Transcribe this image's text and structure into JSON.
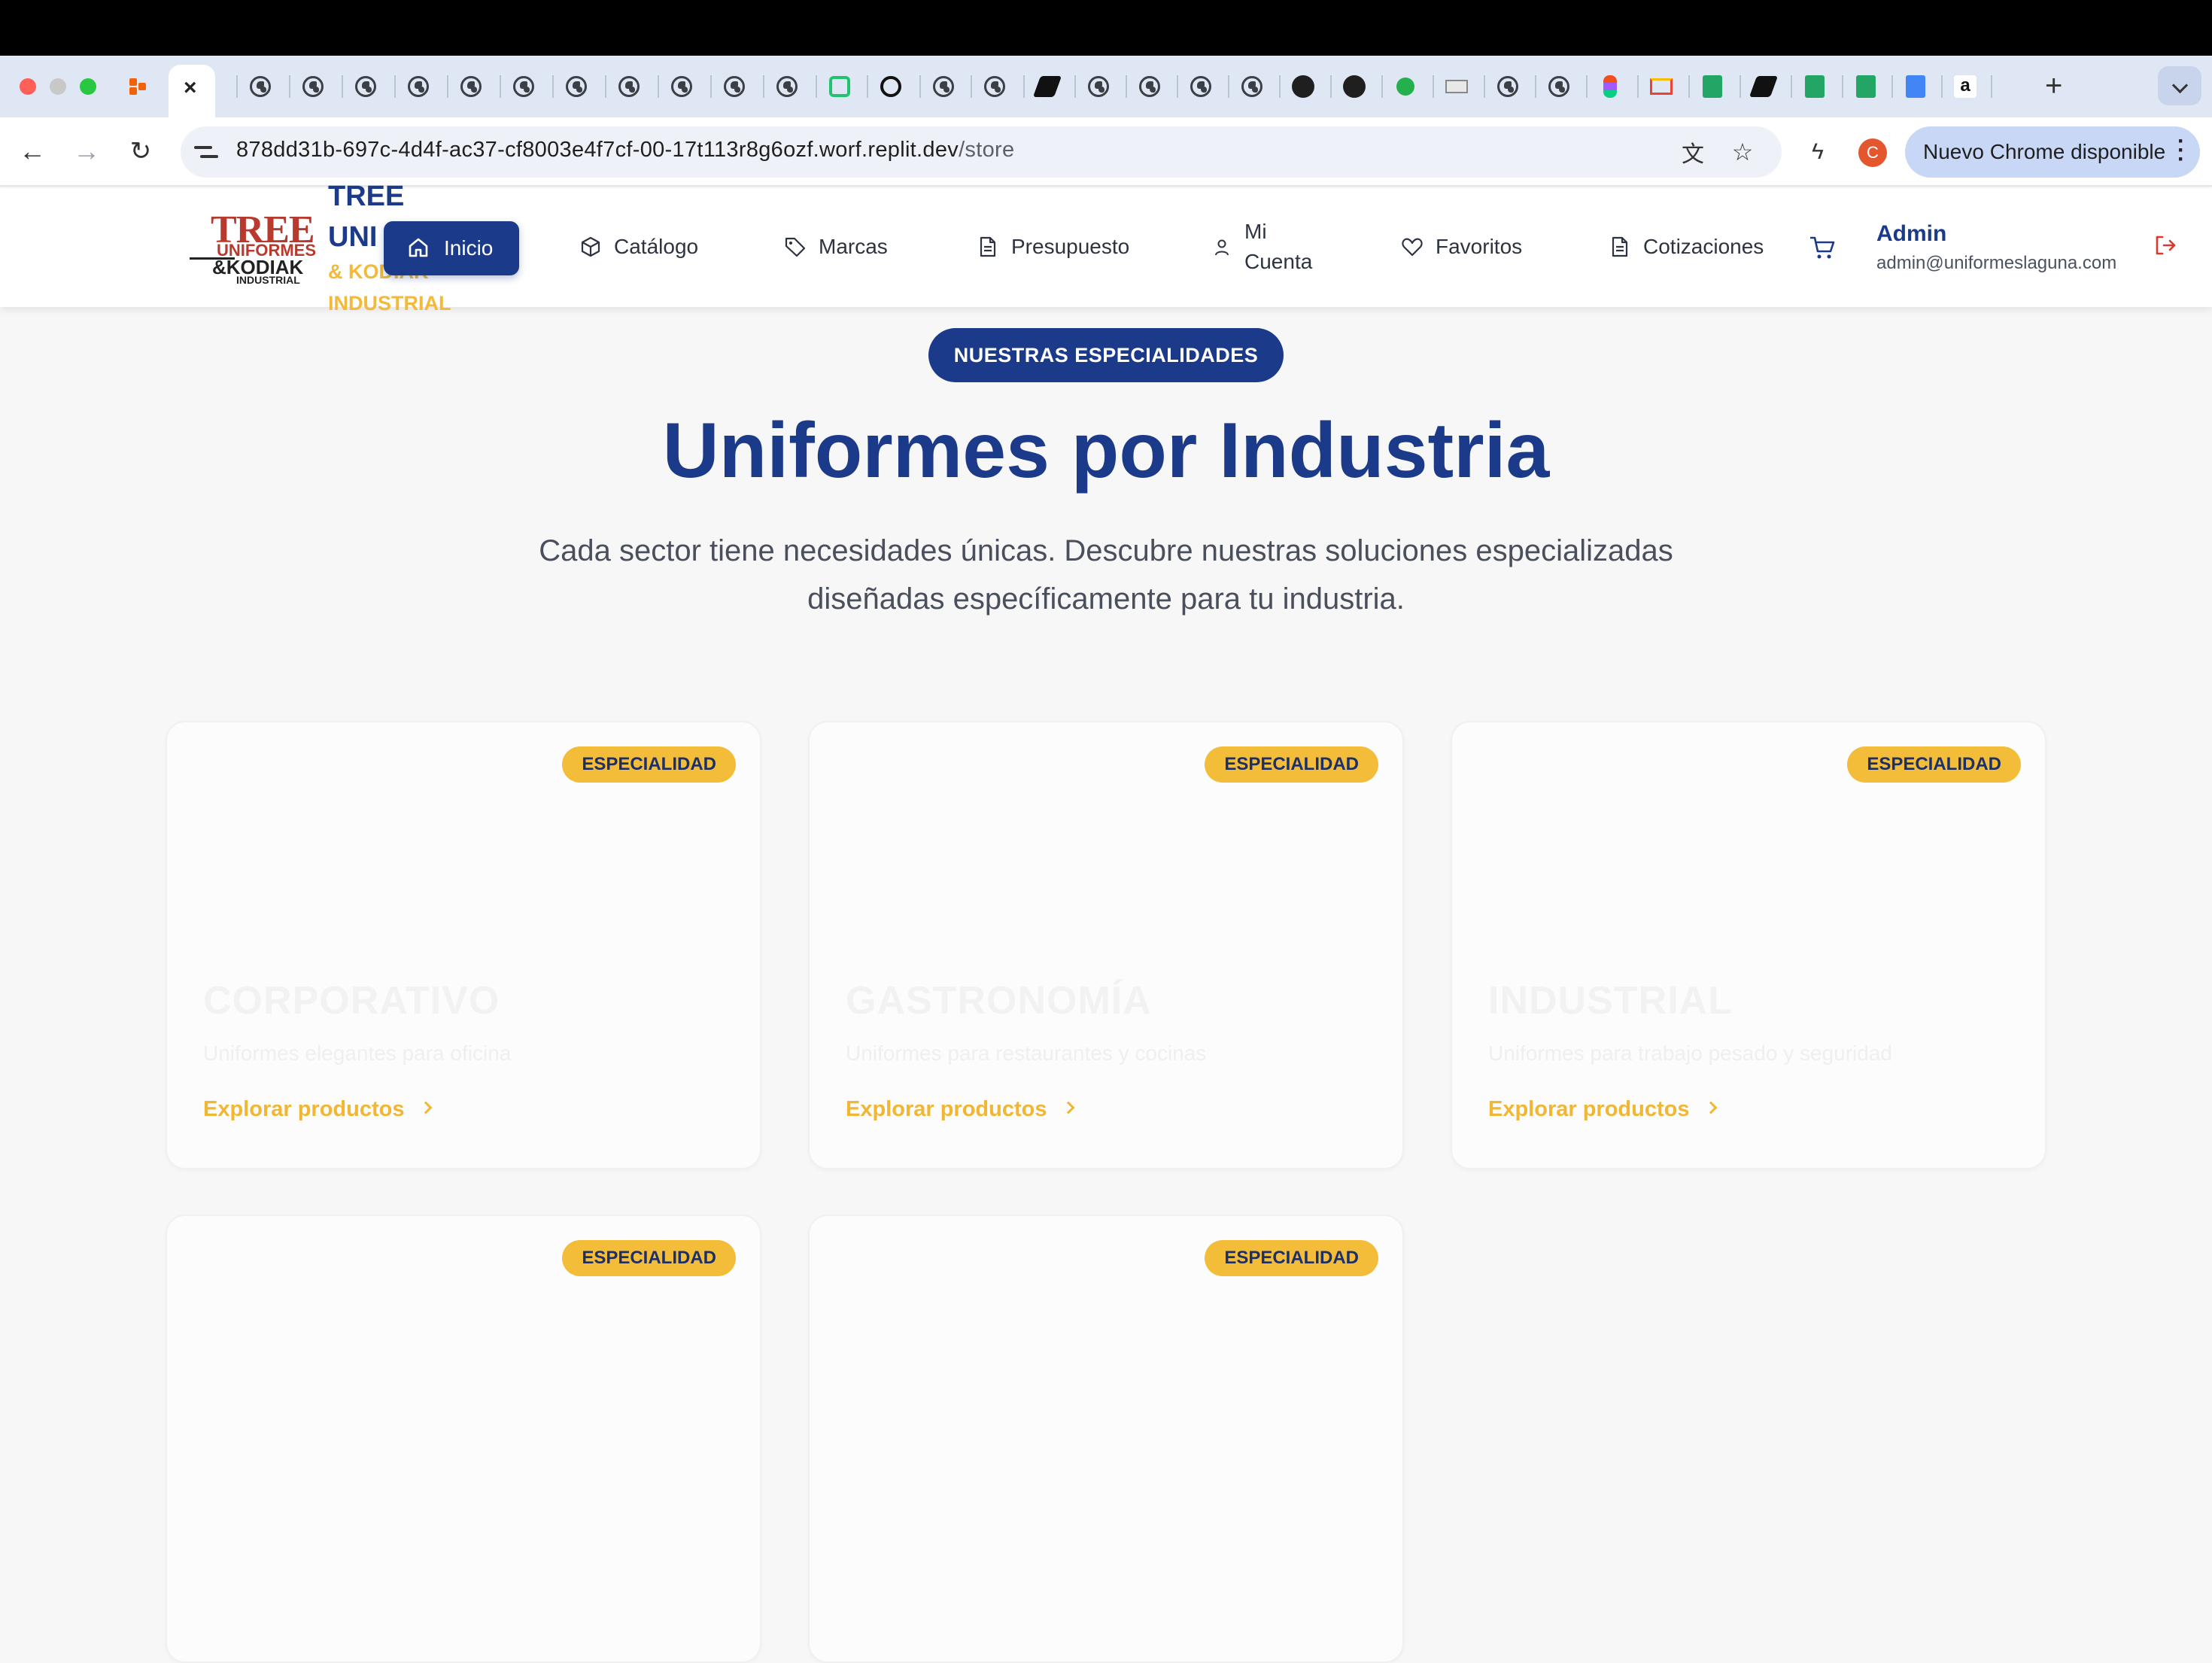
{
  "browser": {
    "url_host": "878dd31b-697c-4d4f-ac37-cf8003e4f7cf-00-17t113r8g6ozf.worf.replit.dev",
    "url_path": "/store",
    "profile_initial": "C",
    "update_label": "Nuevo Chrome disponible",
    "active_tab_close": "×",
    "new_tab": "+"
  },
  "brand": {
    "logo_tree": "TREE",
    "logo_uniformes": "UNIFORMES",
    "logo_kodiak": "&KODIAK",
    "logo_industrial": "INDUSTRIAL",
    "title_line1": "TREE",
    "title_line2": "UNI",
    "title_line3": "& KODIAK",
    "title_line4": "INDUSTRIAL"
  },
  "nav": {
    "inicio": "Inicio",
    "catalogo": "Catálogo",
    "marcas": "Marcas",
    "presupuesto": "Presupuesto",
    "mi_cuenta_1": "Mi",
    "mi_cuenta_2": "Cuenta",
    "favoritos": "Favoritos",
    "cotizaciones": "Cotizaciones"
  },
  "user": {
    "name": "Admin",
    "email": "admin@uniformeslaguna.com"
  },
  "hero": {
    "pill": "NUESTRAS ESPECIALIDADES",
    "title": "Uniformes por Industria",
    "subtitle_1": "Cada sector tiene necesidades únicas. Descubre nuestras soluciones especializadas",
    "subtitle_2": "diseñadas específicamente para tu industria."
  },
  "cards": [
    {
      "badge": "ESPECIALIDAD",
      "title": "CORPORATIVO",
      "desc": "Uniformes elegantes para oficina",
      "link": "Explorar productos"
    },
    {
      "badge": "ESPECIALIDAD",
      "title": "GASTRONOMÍA",
      "desc": "Uniformes para restaurantes y cocinas",
      "link": "Explorar productos"
    },
    {
      "badge": "ESPECIALIDAD",
      "title": "INDUSTRIAL",
      "desc": "Uniformes para trabajo pesado y seguridad",
      "link": "Explorar productos"
    },
    {
      "badge": "ESPECIALIDAD",
      "title": "",
      "desc": "",
      "link": ""
    },
    {
      "badge": "ESPECIALIDAD",
      "title": "",
      "desc": "",
      "link": ""
    }
  ],
  "colors": {
    "primary": "#1c3a8a",
    "accent": "#f3bd3a",
    "logo_red": "#b8392d",
    "logout_red": "#d9382c"
  }
}
